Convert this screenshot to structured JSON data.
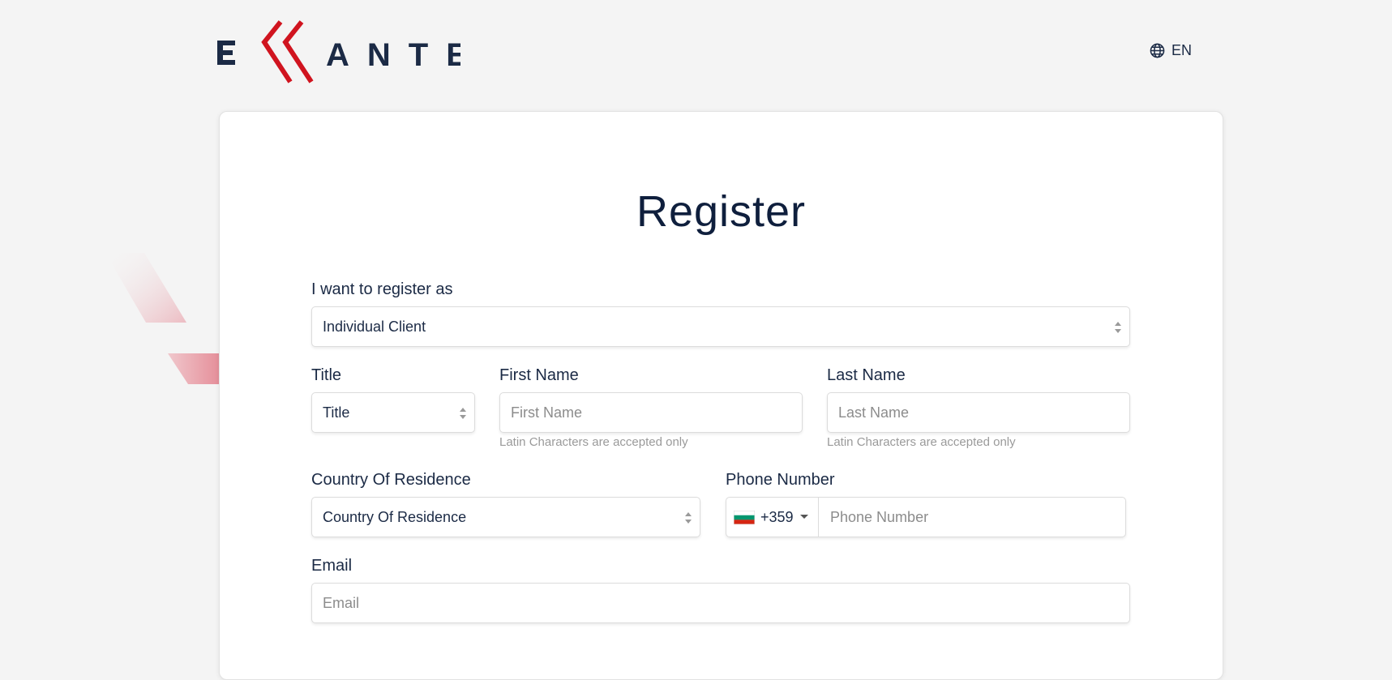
{
  "header": {
    "logo_text": "ERRANTE",
    "lang_label": "EN",
    "lang_icon": "globe-icon"
  },
  "colors": {
    "brand_navy": "#1b2a45",
    "brand_red": "#d0141f",
    "background": "#f4f4f4"
  },
  "form": {
    "title": "Register",
    "register_as": {
      "label": "I want to register as",
      "value": "Individual Client"
    },
    "title_field": {
      "label": "Title",
      "value": "Title"
    },
    "first_name": {
      "label": "First Name",
      "placeholder": "First Name",
      "hint": "Latin Characters are accepted only"
    },
    "last_name": {
      "label": "Last Name",
      "placeholder": "Last Name",
      "hint": "Latin Characters are accepted only"
    },
    "country": {
      "label": "Country Of Residence",
      "value": "Country Of Residence"
    },
    "phone": {
      "label": "Phone Number",
      "dial_code": "+359",
      "placeholder": "Phone Number",
      "flag_icon": "bulgaria-flag-icon"
    },
    "email": {
      "label": "Email",
      "placeholder": "Email"
    }
  }
}
